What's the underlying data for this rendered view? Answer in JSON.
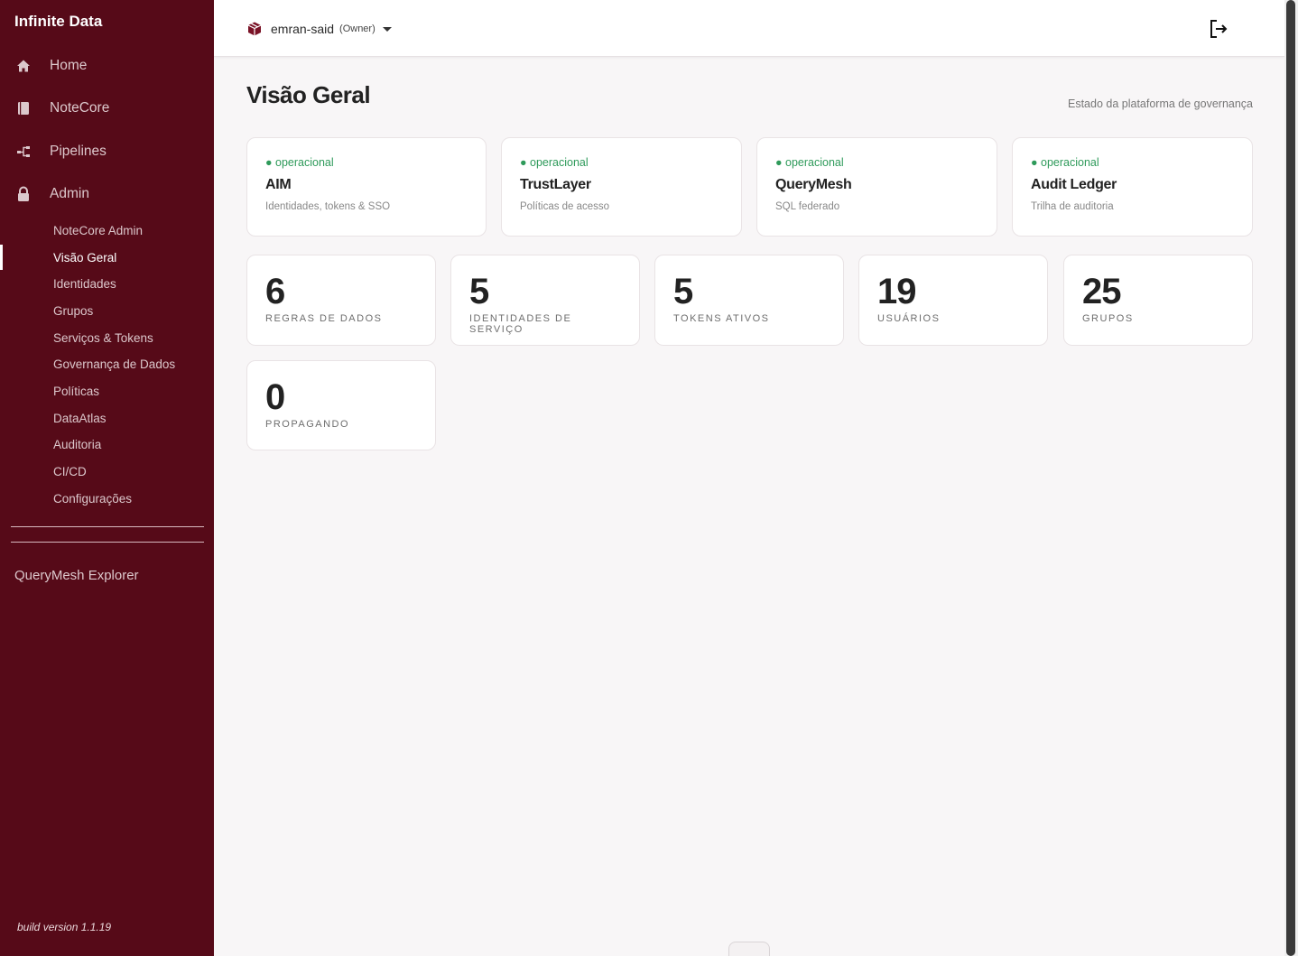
{
  "sidebar": {
    "brand": "Infinite Data",
    "nav": [
      {
        "label": "Home",
        "icon": "home-icon"
      },
      {
        "label": "NoteCore",
        "icon": "notebook-icon"
      },
      {
        "label": "Pipelines",
        "icon": "pipeline-icon"
      },
      {
        "label": "Admin",
        "icon": "lock-icon"
      }
    ],
    "admin_items": [
      "NoteCore Admin",
      "Visão Geral",
      "Identidades",
      "Grupos",
      "Serviços & Tokens",
      "Governança de Dados",
      "Políticas",
      "DataAtlas",
      "Auditoria",
      "CI/CD",
      "Configurações"
    ],
    "active_item": "Visão Geral",
    "explorer": "QueryMesh Explorer",
    "build": "build version 1.1.19"
  },
  "header": {
    "tenant_name": "emran-said",
    "tenant_role": "(Owner)",
    "tenant_icon": "cube-icon",
    "logout_icon": "logout-icon"
  },
  "page": {
    "title": "Visão Geral",
    "subtitle": "Estado da plataforma de governança"
  },
  "services": [
    {
      "status": "● operacional",
      "name": "AIM",
      "desc": "Identidades, tokens & SSO"
    },
    {
      "status": "● operacional",
      "name": "TrustLayer",
      "desc": "Políticas de acesso"
    },
    {
      "status": "● operacional",
      "name": "QueryMesh",
      "desc": "SQL federado"
    },
    {
      "status": "● operacional",
      "name": "Audit Ledger",
      "desc": "Trilha de auditoria"
    }
  ],
  "stats": [
    {
      "value": "6",
      "label": "REGRAS DE DADOS"
    },
    {
      "value": "5",
      "label": "IDENTIDADES DE SERVIÇO"
    },
    {
      "value": "5",
      "label": "TOKENS ATIVOS"
    },
    {
      "value": "19",
      "label": "USUÁRIOS"
    },
    {
      "value": "25",
      "label": "GRUPOS"
    },
    {
      "value": "0",
      "label": "PROPAGANDO"
    }
  ],
  "colors": {
    "sidebar_bg": "#560a18",
    "status_ok": "#2e9a5a"
  }
}
